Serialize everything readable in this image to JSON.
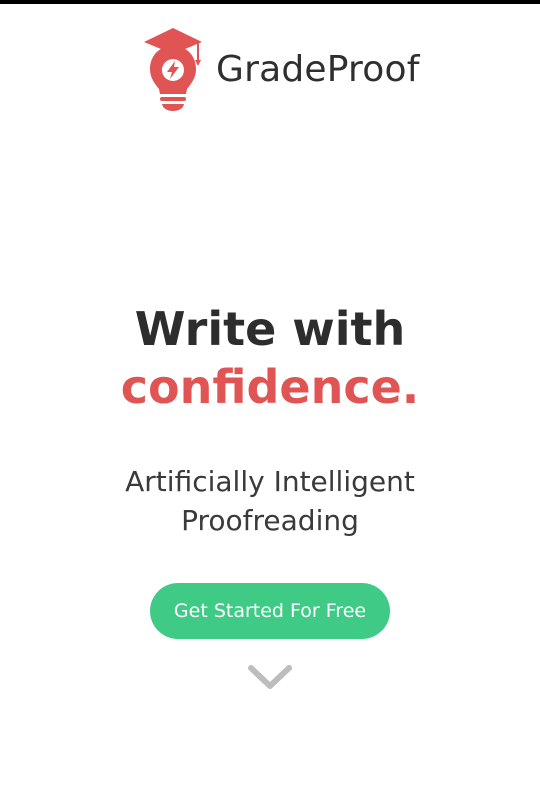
{
  "header": {
    "brand_name": "GradeProof",
    "logo_icon": "lightbulb-graduation-cap-icon"
  },
  "hero": {
    "title_line1": "Write with",
    "title_line2": "confidence.",
    "subtitle_line1": "Artificially Intelligent",
    "subtitle_line2": "Proofreading"
  },
  "cta": {
    "label": "Get Started For Free"
  },
  "scroll": {
    "icon": "chevron-down-icon"
  },
  "colors": {
    "accent_red": "#e05454",
    "cta_green": "#3fcb85",
    "text_dark": "#2d2d2d",
    "chevron_gray": "#bdbdbd"
  }
}
